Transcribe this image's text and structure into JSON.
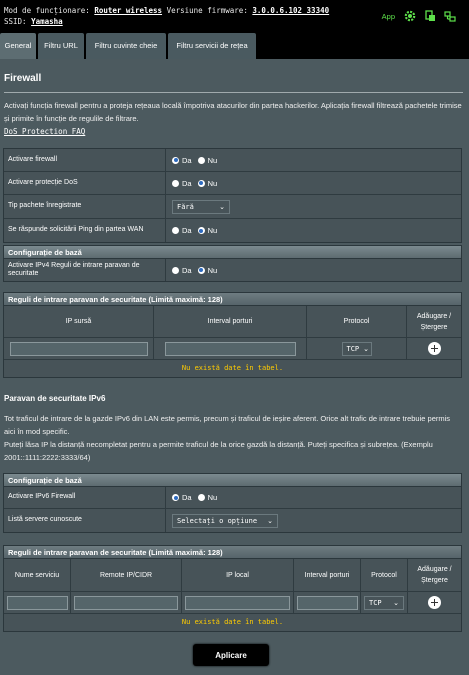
{
  "header": {
    "mode_label": "Mod de funcționare:",
    "mode_value": "Router wireless",
    "firmware_label": "Versiune firmware:",
    "firmware_value": "3.0.0.6.102_33340",
    "ssid_label": "SSID:",
    "ssid_value": "Yamasha",
    "app_label": "App",
    "icons": [
      "gear-icon",
      "usb-icon",
      "network-icon"
    ]
  },
  "tabs": [
    {
      "label": "General",
      "active": true
    },
    {
      "label": "Filtru URL",
      "active": false
    },
    {
      "label": "Filtru cuvinte cheie",
      "active": false
    },
    {
      "label": "Filtru servicii de rețea",
      "active": false
    }
  ],
  "page": {
    "title": "Firewall",
    "description": "Activați funcția firewall pentru a proteja rețeaua locală împotriva atacurilor din partea hackerilor. Aplicația firewall filtrează pachetele trimise și primite în funcție de regulile de filtrare.",
    "faq_link": "DoS Protection FAQ"
  },
  "general_settings": [
    {
      "label": "Activare firewall",
      "type": "radio",
      "options": [
        "Da",
        "Nu"
      ],
      "selected": "Da"
    },
    {
      "label": "Activare protecție DoS",
      "type": "radio",
      "options": [
        "Da",
        "Nu"
      ],
      "selected": "Nu"
    },
    {
      "label": "Tip pachete înregistrate",
      "type": "select",
      "value": "Fără"
    },
    {
      "label": "Se răspunde solicitării Ping din partea WAN",
      "type": "radio",
      "options": [
        "Da",
        "Nu"
      ],
      "selected": "Nu"
    }
  ],
  "ipv4_basic": {
    "header": "Configurație de bază",
    "label": "Activare IPv4 Reguli de intrare paravan de securitate",
    "options": [
      "Da",
      "Nu"
    ],
    "selected": "Nu"
  },
  "ipv4_rules": {
    "header": "Reguli de intrare paravan de securitate (Limită maximă: 128)",
    "columns": [
      "IP sursă",
      "Interval porturi",
      "Protocol",
      "Adăugare / Ștergere"
    ],
    "protocol_value": "TCP",
    "empty_text": "Nu există date în tabel."
  },
  "ipv6": {
    "title": "Paravan de securitate IPv6",
    "description1": "Tot traficul de intrare de la gazde IPv6 din LAN este permis, precum și traficul de ieșire aferent. Orice alt trafic de intrare trebuie permis aici în mod specific.",
    "description2": "Puteți lăsa IP la distanță necompletat pentru a permite traficul de la orice gazdă la distanță. Puteți specifica și subrețea. (Exemplu 2001::1111:2222:3333/64)",
    "basic_header": "Configurație de bază",
    "enable_label": "Activare IPv6 Firewall",
    "enable_options": [
      "Da",
      "Nu"
    ],
    "enable_selected": "Da",
    "servers_label": "Listă servere cunoscute",
    "servers_value": "Selectați o opțiune"
  },
  "ipv6_rules": {
    "header": "Reguli de intrare paravan de securitate (Limită maximă: 128)",
    "columns": [
      "Nume serviciu",
      "Remote IP/CIDR",
      "IP local",
      "Interval porturi",
      "Protocol",
      "Adăugare / Ștergere"
    ],
    "protocol_value": "TCP",
    "empty_text": "Nu există date în tabel."
  },
  "apply_button": "Aplicare",
  "colors": {
    "accent_green": "#5ee14b",
    "empty_text": "#ffcc00",
    "radio_selected": "#2f6cc1"
  }
}
